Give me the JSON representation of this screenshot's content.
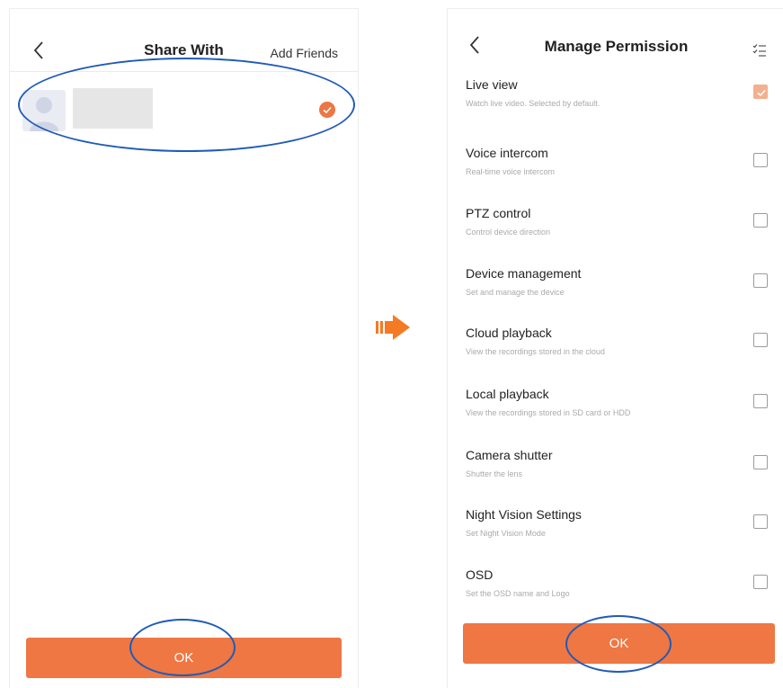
{
  "share_screen": {
    "title": "Share With",
    "add_friends_label": "Add Friends",
    "ok_label": "OK"
  },
  "permission_screen": {
    "title": "Manage Permission",
    "ok_label": "OK",
    "permissions": [
      {
        "name": "Live view",
        "desc": "Watch live video. Selected by default.",
        "checked": true
      },
      {
        "name": "Voice intercom",
        "desc": "Real-time voice intercom",
        "checked": false
      },
      {
        "name": "PTZ control",
        "desc": "Control device direction",
        "checked": false
      },
      {
        "name": "Device management",
        "desc": "Set and manage the device",
        "checked": false
      },
      {
        "name": "Cloud playback",
        "desc": "View the recordings stored in the cloud",
        "checked": false
      },
      {
        "name": "Local playback",
        "desc": "View the recordings stored in SD card or HDD",
        "checked": false
      },
      {
        "name": "Camera shutter",
        "desc": "Shutter the lens",
        "checked": false
      },
      {
        "name": "Night Vision Settings",
        "desc": "Set Night Vision Mode",
        "checked": false
      },
      {
        "name": "OSD",
        "desc": "Set the OSD name and Logo",
        "checked": false
      }
    ]
  },
  "colors": {
    "accent": "#ee7743",
    "annotation": "#1f5bb8"
  }
}
